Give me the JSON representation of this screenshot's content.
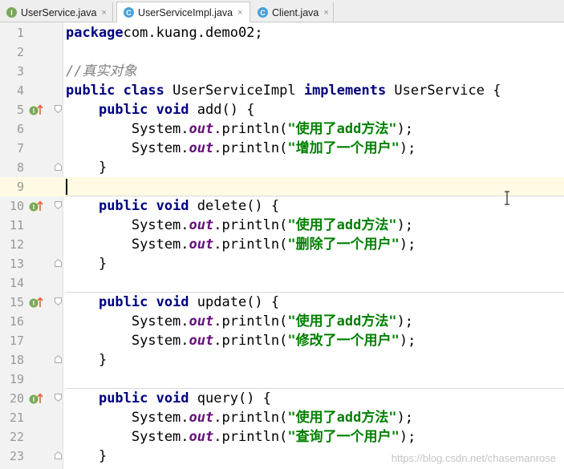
{
  "tabs": [
    {
      "icon": "interface-icon",
      "icon_letter": "I",
      "label": "UserService.java",
      "active": false
    },
    {
      "icon": "class-icon",
      "icon_letter": "C",
      "label": "UserServiceImpl.java",
      "active": true
    },
    {
      "icon": "class-icon",
      "icon_letter": "C",
      "label": "Client.java",
      "active": false
    }
  ],
  "close_glyph": "×",
  "code": {
    "current_line": 9,
    "lines": [
      {
        "n": "1",
        "seg": [
          [
            "kw",
            "package"
          ],
          [
            "",
            "com.kuang.demo02;"
          ]
        ]
      },
      {
        "n": "2",
        "seg": []
      },
      {
        "n": "3",
        "seg": [
          [
            "cm",
            "//真实对象"
          ]
        ]
      },
      {
        "n": "4",
        "seg": [
          [
            "kw",
            "public class "
          ],
          [
            "",
            "UserServiceImpl "
          ],
          [
            "kw",
            "implements "
          ],
          [
            "",
            "UserService {"
          ]
        ]
      },
      {
        "n": "5",
        "marker": true,
        "fold": "open",
        "seg": [
          [
            "",
            "    "
          ],
          [
            "kw",
            "public void "
          ],
          [
            "",
            "add() {"
          ]
        ]
      },
      {
        "n": "6",
        "seg": [
          [
            "",
            "        System."
          ],
          [
            "fld",
            "out"
          ],
          [
            "",
            ".println("
          ],
          [
            "str",
            "\"使用了add方法\""
          ],
          [
            "",
            ");"
          ]
        ]
      },
      {
        "n": "7",
        "seg": [
          [
            "",
            "        System."
          ],
          [
            "fld",
            "out"
          ],
          [
            "",
            ".println("
          ],
          [
            "str",
            "\"增加了一个用户\""
          ],
          [
            "",
            ");"
          ]
        ]
      },
      {
        "n": "8",
        "fold": "close",
        "seg": [
          [
            "",
            "    }"
          ]
        ]
      },
      {
        "n": "9",
        "seg": []
      },
      {
        "n": "10",
        "marker": true,
        "fold": "open",
        "sep": true,
        "seg": [
          [
            "",
            "    "
          ],
          [
            "kw",
            "public void "
          ],
          [
            "",
            "delete() {"
          ]
        ]
      },
      {
        "n": "11",
        "seg": [
          [
            "",
            "        System."
          ],
          [
            "fld",
            "out"
          ],
          [
            "",
            ".println("
          ],
          [
            "str",
            "\"使用了add方法\""
          ],
          [
            "",
            ");"
          ]
        ]
      },
      {
        "n": "12",
        "seg": [
          [
            "",
            "        System."
          ],
          [
            "fld",
            "out"
          ],
          [
            "",
            ".println("
          ],
          [
            "str",
            "\"删除了一个用户\""
          ],
          [
            "",
            ");"
          ]
        ]
      },
      {
        "n": "13",
        "fold": "close",
        "seg": [
          [
            "",
            "    }"
          ]
        ]
      },
      {
        "n": "14",
        "seg": []
      },
      {
        "n": "15",
        "marker": true,
        "fold": "open",
        "sep": true,
        "seg": [
          [
            "",
            "    "
          ],
          [
            "kw",
            "public void "
          ],
          [
            "",
            "update() {"
          ]
        ]
      },
      {
        "n": "16",
        "seg": [
          [
            "",
            "        System."
          ],
          [
            "fld",
            "out"
          ],
          [
            "",
            ".println("
          ],
          [
            "str",
            "\"使用了add方法\""
          ],
          [
            "",
            ");"
          ]
        ]
      },
      {
        "n": "17",
        "seg": [
          [
            "",
            "        System."
          ],
          [
            "fld",
            "out"
          ],
          [
            "",
            ".println("
          ],
          [
            "str",
            "\"修改了一个用户\""
          ],
          [
            "",
            ");"
          ]
        ]
      },
      {
        "n": "18",
        "fold": "close",
        "seg": [
          [
            "",
            "    }"
          ]
        ]
      },
      {
        "n": "19",
        "seg": []
      },
      {
        "n": "20",
        "marker": true,
        "fold": "open",
        "sep": true,
        "seg": [
          [
            "",
            "    "
          ],
          [
            "kw",
            "public void "
          ],
          [
            "",
            "query() {"
          ]
        ]
      },
      {
        "n": "21",
        "seg": [
          [
            "",
            "        System."
          ],
          [
            "fld",
            "out"
          ],
          [
            "",
            ".println("
          ],
          [
            "str",
            "\"使用了add方法\""
          ],
          [
            "",
            ");"
          ]
        ]
      },
      {
        "n": "22",
        "seg": [
          [
            "",
            "        System."
          ],
          [
            "fld",
            "out"
          ],
          [
            "",
            ".println("
          ],
          [
            "str",
            "\"查询了一个用户\""
          ],
          [
            "",
            ");"
          ]
        ]
      },
      {
        "n": "23",
        "fold": "close",
        "seg": [
          [
            "",
            "    }"
          ]
        ]
      }
    ]
  },
  "watermark": "https://blog.csdn.net/chasemanrose",
  "colors": {
    "keyword": "#000080",
    "string": "#008000",
    "comment": "#808080",
    "field": "#660e7a",
    "gutter_marker": "#e0602b"
  }
}
